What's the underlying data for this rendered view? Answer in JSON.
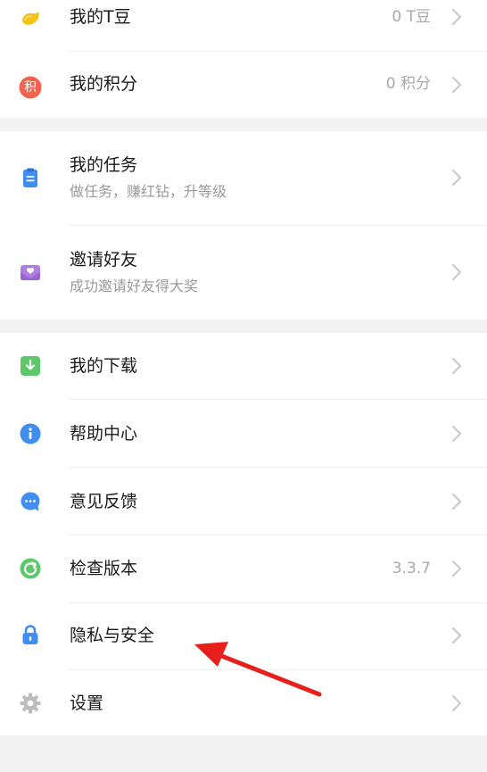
{
  "groups": [
    {
      "items": [
        {
          "title": "我的T豆",
          "value": "0 T豆",
          "icon": "bean-icon"
        },
        {
          "title": "我的积分",
          "value": "0 积分",
          "icon": "points-icon",
          "icon_text": "积"
        }
      ]
    },
    {
      "items": [
        {
          "title": "我的任务",
          "subtitle": "做任务，赚红钻，升等级",
          "icon": "clipboard-icon"
        },
        {
          "title": "邀请好友",
          "subtitle": "成功邀请好友得大奖",
          "icon": "invite-heart-icon"
        }
      ]
    },
    {
      "items": [
        {
          "title": "我的下载",
          "icon": "download-icon"
        },
        {
          "title": "帮助中心",
          "icon": "info-icon"
        },
        {
          "title": "意见反馈",
          "icon": "chat-bubble-icon"
        },
        {
          "title": "检查版本",
          "value": "3.3.7",
          "icon": "refresh-icon"
        },
        {
          "title": "隐私与安全",
          "icon": "lock-icon"
        },
        {
          "title": "设置",
          "icon": "gear-icon"
        }
      ]
    }
  ],
  "colors": {
    "bean": "#f5c316",
    "points": "#f0644e",
    "clipboard": "#3f8ef0",
    "invite": "#b27de0",
    "download": "#5cc86a",
    "info": "#3f8ef0",
    "feedback": "#3f8ef0",
    "version": "#5cc86a",
    "lock": "#3f8ef0",
    "gear": "#bdbdbd",
    "annotation_arrow": "#e8201c"
  },
  "annotation": {
    "points_to": "隐私与安全"
  }
}
